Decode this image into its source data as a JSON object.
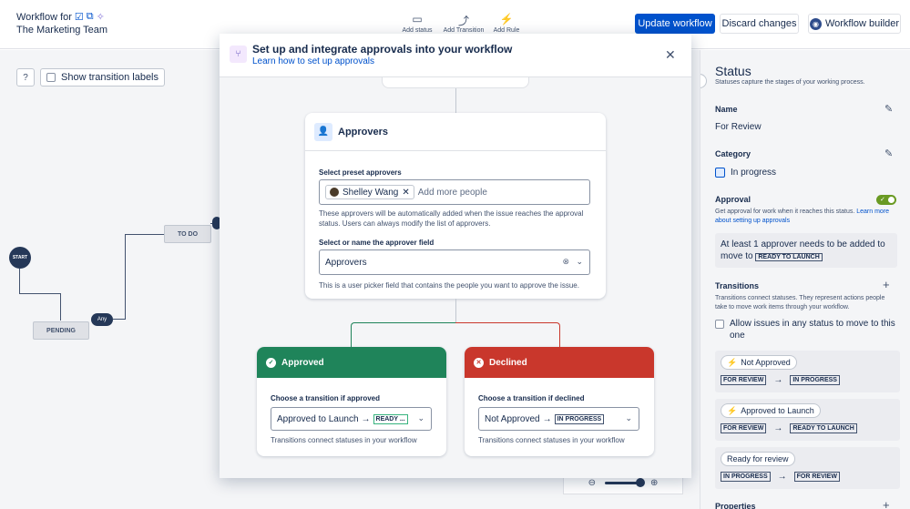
{
  "header": {
    "title": "Workflow for",
    "team": "The Marketing Team",
    "tools": [
      {
        "icon": "status-icon",
        "label": "Add status"
      },
      {
        "icon": "transition-icon",
        "label": "Add Transition"
      },
      {
        "icon": "rule-icon",
        "label": "Add Rule"
      }
    ],
    "update_label": "Update workflow",
    "discard_label": "Discard changes",
    "builder_label": "Workflow builder"
  },
  "canvas": {
    "show_labels": "Show transition labels",
    "nodes": {
      "start": "START",
      "todo": "TO DO",
      "pending": "PENDING",
      "any": "Any"
    }
  },
  "modal": {
    "title": "Set up and integrate approvals into your workflow",
    "link": "Learn how to set up approvals",
    "approvers_card": {
      "title": "Approvers",
      "preset_label": "Select preset approvers",
      "chip_name": "Shelley Wang",
      "add_placeholder": "Add more people",
      "preset_hint": "These approvers will be automatically added when the issue reaches the approval status. Users can always modify the list of approvers.",
      "field_label": "Select or name the approver field",
      "field_value": "Approvers",
      "field_hint": "This is a user picker field that contains the people you want to approve the issue."
    },
    "approved": {
      "title": "Approved",
      "label": "Choose a transition if approved",
      "value": "Approved to Launch",
      "target": "READY ...",
      "hint": "Transitions connect statuses in your workflow",
      "color": "#1f845a"
    },
    "declined": {
      "title": "Declined",
      "label": "Choose a transition if declined",
      "value": "Not Approved",
      "target": "IN PROGRESS",
      "hint": "Transitions connect statuses in your workflow",
      "color": "#c9372c"
    }
  },
  "panel": {
    "title": "Status",
    "subtitle": "Statuses capture the stages of your working process.",
    "name_label": "Name",
    "name_value": "For Review",
    "category_label": "Category",
    "category_value": "In progress",
    "approval_label": "Approval",
    "approval_desc": "Get approval for work when it reaches this status.",
    "approval_link": "Learn more about setting up approvals",
    "approver_text": "At least 1 approver needs to be added to move to",
    "approver_target": "READY TO LAUNCH",
    "transitions_label": "Transitions",
    "transitions_desc": "Transitions connect statuses. They represent actions people take to move work items through your workflow.",
    "allow_text": "Allow issues in any status to move to this one",
    "transitions": [
      {
        "name": "Not Approved",
        "from": "FOR REVIEW",
        "to": "IN PROGRESS",
        "bolt": true
      },
      {
        "name": "Approved to Launch",
        "from": "FOR REVIEW",
        "to": "READY TO LAUNCH",
        "bolt": true
      },
      {
        "name": "Ready for review",
        "from": "IN PROGRESS",
        "to": "FOR REVIEW",
        "bolt": false
      }
    ],
    "properties_label": "Properties"
  }
}
